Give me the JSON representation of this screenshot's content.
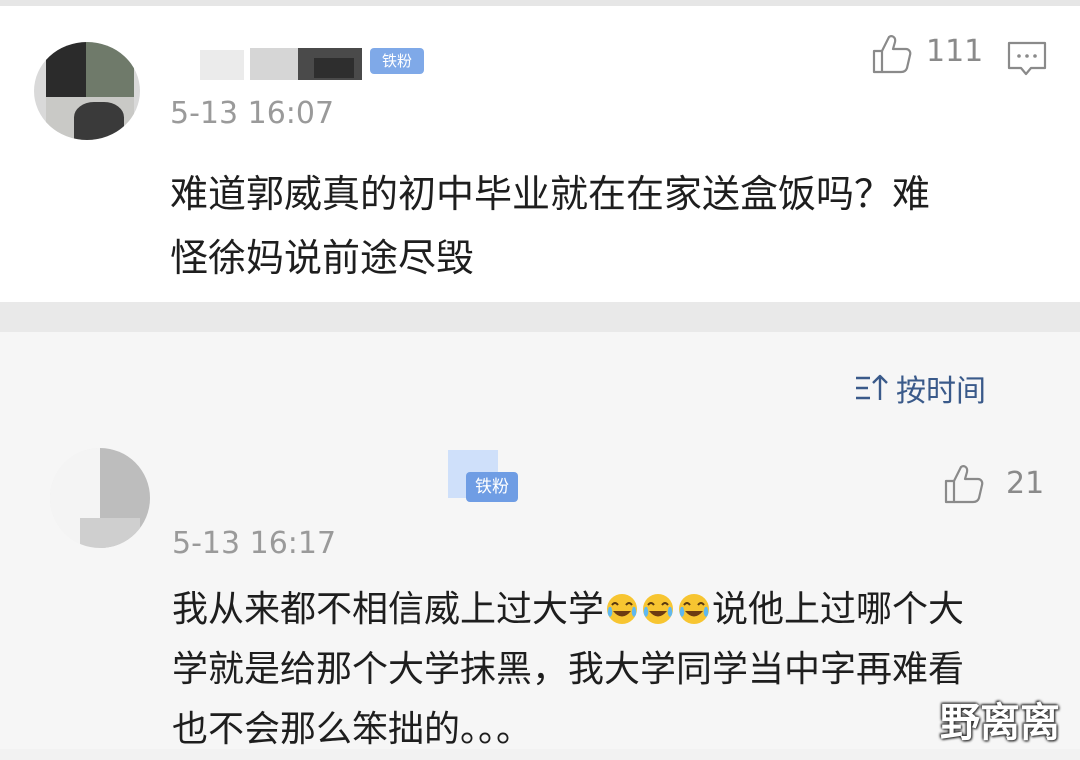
{
  "comment": {
    "badge": "铁粉",
    "time": "5-13 16:07",
    "likes": "111",
    "text_line1": "难道郭威真的初中毕业就在在家送盒饭吗？难",
    "text_line2": "怪徐妈说前途尽毁"
  },
  "sort": {
    "label": "按时间"
  },
  "reply": {
    "badge": "铁粉",
    "time": "5-13 16:17",
    "likes": "21",
    "text_part1": "我从来都不相信威上过大学",
    "emoji": "😂",
    "text_part2": "说他上过哪个大",
    "text_line2": "学就是给那个大学抹黑，我大学同学当中字再难看",
    "text_line3": "也不会那么笨拙的。。。"
  },
  "icons": {
    "like": "thumbs-up-icon",
    "comment": "comment-bubble-icon",
    "sort": "sort-icon",
    "emoji": "tears-of-joy-emoji-icon"
  },
  "colors": {
    "badge": "#7fa9e8",
    "sort_text": "#3a5a8a",
    "time_text": "#9a9a9a",
    "body_text": "#1e1e1e"
  },
  "watermark": "野离离"
}
